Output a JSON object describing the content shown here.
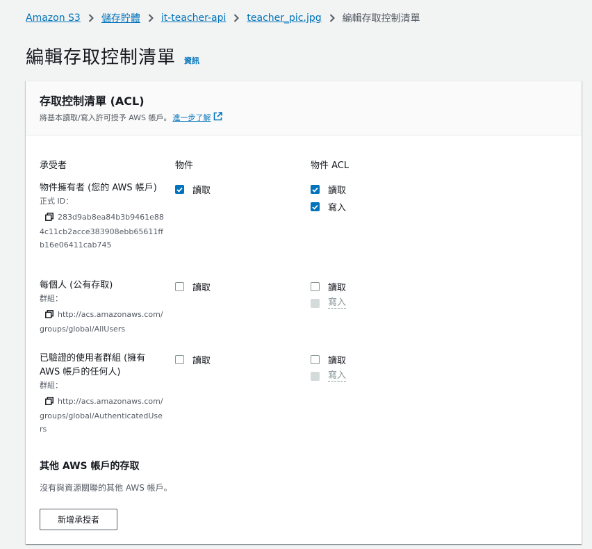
{
  "breadcrumbs": {
    "items": [
      "Amazon S3",
      "儲存貯體",
      "it-teacher-api",
      "teacher_pic.jpg"
    ],
    "current": "編輯存取控制清單"
  },
  "header": {
    "title": "編輯存取控制清單",
    "info": "資訊"
  },
  "acl": {
    "title": "存取控制清單 (ACL)",
    "description": "將基本讀取/寫入許可授予 AWS 帳戶。",
    "learn_more": "進一步了解",
    "columns": {
      "grantee": "承受者",
      "objects": "物件",
      "object_acl": "物件 ACL"
    },
    "rows": [
      {
        "grantee": "物件擁有者 (您的 AWS 帳戶)",
        "sub_label": "正式 ID：",
        "id_value": "283d9ab8ea84b3b9461e884c11cb2acce383908ebb65611ffb16e06411cab745",
        "objects_read": "讀取",
        "objects_read_checked": true,
        "acl_read": "讀取",
        "acl_read_checked": true,
        "acl_write": "寫入",
        "acl_write_checked": true
      },
      {
        "grantee": "每個人 (公有存取)",
        "sub_label": "群組：",
        "id_value": "http://acs.amazonaws.com/groups/global/AllUsers",
        "objects_read": "讀取",
        "objects_read_checked": false,
        "acl_read": "讀取",
        "acl_read_checked": false,
        "acl_write": "寫入",
        "acl_write_disabled": true
      },
      {
        "grantee": "已驗證的使用者群組 (擁有 AWS 帳戶的任何人)",
        "sub_label": "群組：",
        "id_value": "http://acs.amazonaws.com/groups/global/AuthenticatedUsers",
        "objects_read": "讀取",
        "objects_read_checked": false,
        "acl_read": "讀取",
        "acl_read_checked": false,
        "acl_write": "寫入",
        "acl_write_disabled": true
      }
    ]
  },
  "other_accounts": {
    "title": "其他 AWS 帳戶的存取",
    "description": "沒有與資源關聯的其他 AWS 帳戶。",
    "add_button": "新增承授者"
  },
  "colors": {
    "link": "#0073bb",
    "checkbox_checked": "#0073bb",
    "background": "#f2f3f3"
  }
}
